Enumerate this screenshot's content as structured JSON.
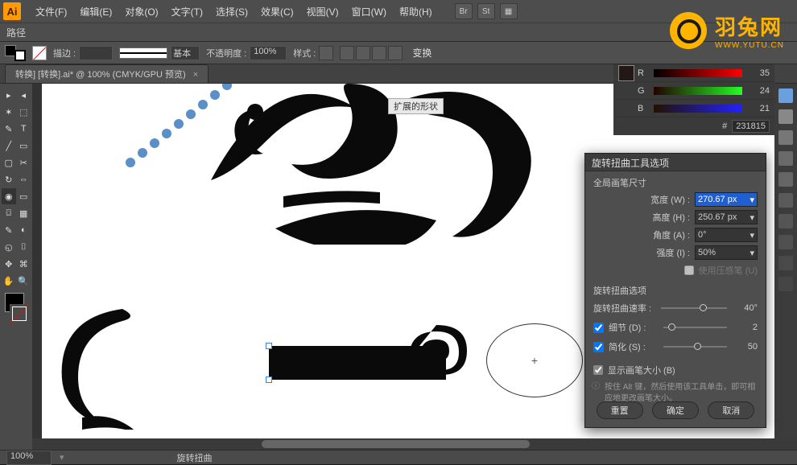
{
  "app": {
    "logo": "Ai"
  },
  "menu": {
    "file": "文件(F)",
    "edit": "编辑(E)",
    "object": "对象(O)",
    "type": "文字(T)",
    "select": "选择(S)",
    "effect": "效果(C)",
    "view": "视图(V)",
    "window": "窗口(W)",
    "help": "帮助(H)"
  },
  "menu_icons": [
    "Br",
    "St",
    "▦"
  ],
  "breadcrumb": "路径",
  "props": {
    "stroke_label": "描边 :",
    "stroke_width": "",
    "stroke_width_placeholder": "",
    "profile_label": "基本",
    "opacity_label": "不透明度 :",
    "opacity": "100%",
    "style_label": "样式 :",
    "transform_btn": "变换"
  },
  "document_tab": "转换]  [转换].ai* @ 100% (CMYK/GPU 预览) ",
  "tools": [
    "▸",
    "◂",
    "✶",
    "⬚",
    "✎",
    "T",
    "╱",
    "▭",
    "▢",
    "✂",
    "↻",
    "⇔",
    "◉",
    "▭",
    "⌼",
    "▦",
    "✎",
    "◐",
    "◵",
    "⌷",
    "✥",
    "⌘",
    "✋",
    "🔍",
    "⬚"
  ],
  "shape_hover_label": "扩展的形状",
  "color_panel": {
    "r": {
      "label": "R",
      "value": "35"
    },
    "g": {
      "label": "G",
      "value": "24"
    },
    "b": {
      "label": "B",
      "value": "21"
    },
    "hex_label": "#",
    "hex": "231815"
  },
  "dialog": {
    "title": "旋转扭曲工具选项",
    "section1": "全局画笔尺寸",
    "width_label": "宽度 (W) :",
    "width_val": "270.67 px",
    "height_label": "高度 (H) :",
    "height_val": "250.67 px",
    "angle_label": "角度 (A) :",
    "angle_val": "0°",
    "intensity_label": "强度 (I) :",
    "intensity_val": "50%",
    "pressure_cb": "使用压感笔 (U)",
    "section2": "旋转扭曲选项",
    "rate_label": "旋转扭曲速率 :",
    "rate_val": "40°",
    "detail_cb": "细节 (D) :",
    "detail_val": "2",
    "simplify_cb": "简化 (S) :",
    "simplify_val": "50",
    "showsize_cb": "显示画笔大小 (B)",
    "help_text": "按住 Alt 键，然后使用该工具单击，即可相应地更改画笔大小。",
    "reset_btn": "重置",
    "ok_btn": "确定",
    "cancel_btn": "取消"
  },
  "status": {
    "zoom": "100%",
    "tool": "旋转扭曲"
  },
  "watermark": {
    "cn": "羽兔网",
    "en": "WWW.YUTU.CN"
  }
}
